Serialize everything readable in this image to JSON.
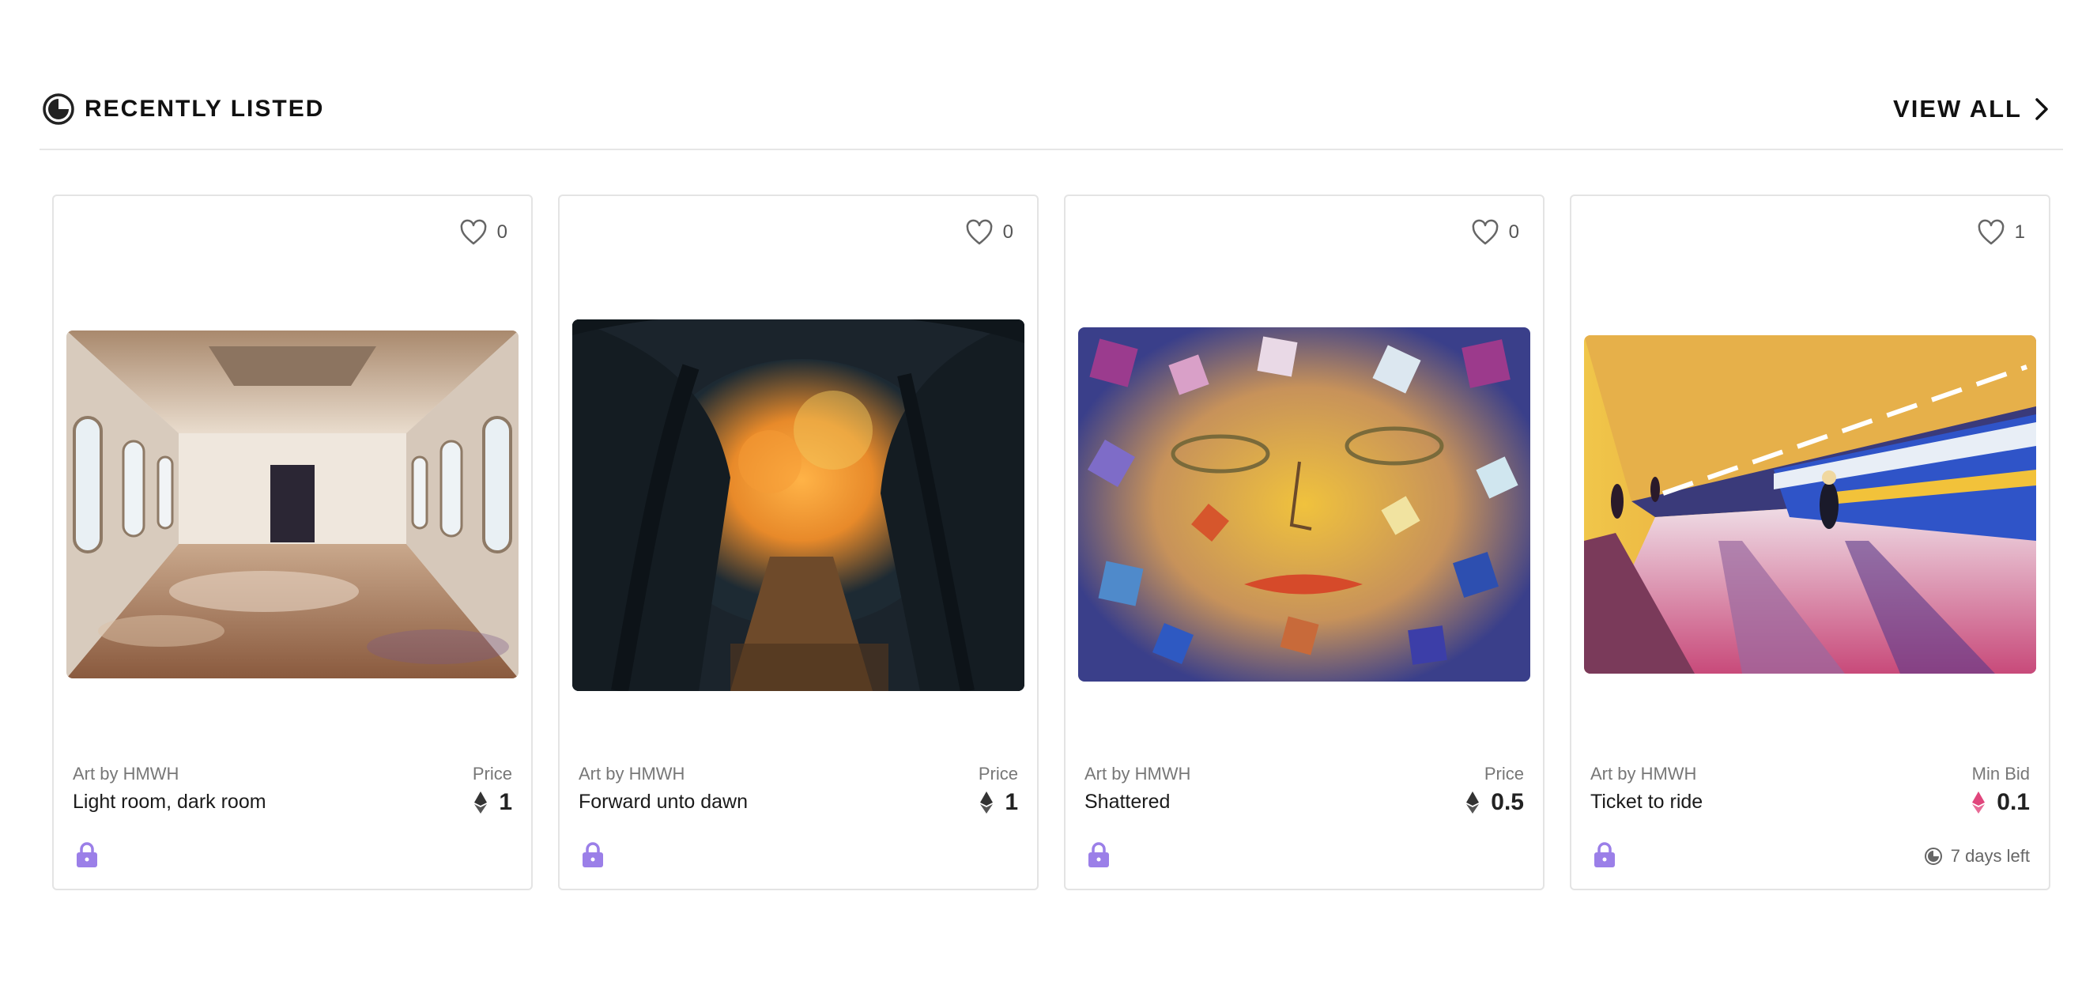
{
  "section": {
    "title": "RECENTLY LISTED",
    "title_icon": "clock-icon",
    "view_all_label": "VIEW ALL",
    "view_all_icon": "chevron-right-icon"
  },
  "colors": {
    "accent_purple": "#9b7fe8",
    "eth_dark": "#333333",
    "eth_pink": "#e0467c"
  },
  "cards": [
    {
      "likes": "0",
      "artist": "Art by HMWH",
      "title": "Light room, dark room",
      "price_label": "Price",
      "price": "1",
      "currency_icon": "eth-icon",
      "lock_icon": "lock-icon"
    },
    {
      "likes": "0",
      "artist": "Art by HMWH",
      "title": "Forward unto dawn",
      "price_label": "Price",
      "price": "1",
      "currency_icon": "eth-icon",
      "lock_icon": "lock-icon"
    },
    {
      "likes": "0",
      "artist": "Art by HMWH",
      "title": "Shattered",
      "price_label": "Price",
      "price": "0.5",
      "currency_icon": "eth-icon",
      "lock_icon": "lock-icon"
    },
    {
      "likes": "1",
      "artist": "Art by HMWH",
      "title": "Ticket to ride",
      "price_label": "Min Bid",
      "price": "0.1",
      "currency_icon": "eth-icon",
      "lock_icon": "lock-icon",
      "time_left": "7 days left"
    }
  ]
}
